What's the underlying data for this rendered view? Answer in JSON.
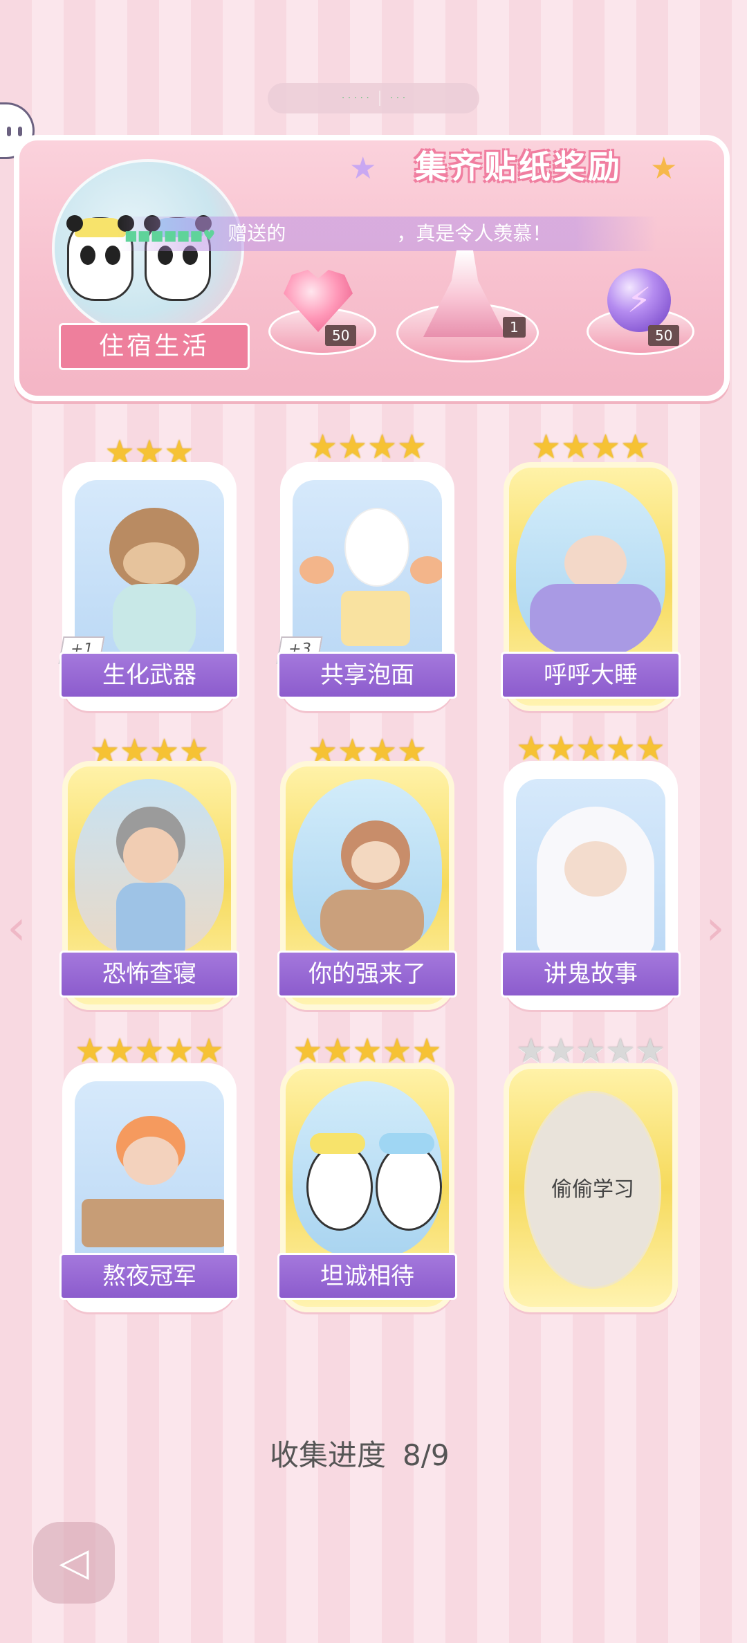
{
  "topbar": {
    "left_text": "· · · · ·",
    "right_text": "· · ·"
  },
  "banner": {
    "title": "集齐贴纸奖励",
    "ribbon_label": "住宿生活",
    "scroll_name": "■■■■■■♥",
    "scroll_text_gift": "赠送的",
    "scroll_text_envy": "，真是令人羡慕！",
    "rewards": [
      {
        "icon": "heart-gem-icon",
        "count": "50"
      },
      {
        "icon": "dress-icon",
        "count": "1"
      },
      {
        "icon": "orb-icon",
        "count": "50"
      }
    ]
  },
  "cards": [
    {
      "label": "生化武器",
      "stars": 3,
      "style": "white",
      "plus": "+1"
    },
    {
      "label": "共享泡面",
      "stars": 4,
      "style": "white",
      "plus": "+3"
    },
    {
      "label": "呼呼大睡",
      "stars": 4,
      "style": "gold"
    },
    {
      "label": "恐怖查寝",
      "stars": 4,
      "style": "gold"
    },
    {
      "label": "你的强来了",
      "stars": 4,
      "style": "gold"
    },
    {
      "label": "讲鬼故事",
      "stars": 5,
      "style": "white"
    },
    {
      "label": "熬夜冠军",
      "stars": 5,
      "style": "white"
    },
    {
      "label": "坦诚相待",
      "stars": 5,
      "style": "gold"
    },
    {
      "label": "偷偷学习",
      "stars": 5,
      "style": "gold",
      "locked": true
    }
  ],
  "progress": {
    "label": "收集进度",
    "value": "8/9"
  },
  "nav": {
    "left_arrow": "‹",
    "right_arrow": "›",
    "back_icon": "◁"
  },
  "colors": {
    "ribbon_purple": "#9a6ad6",
    "banner_pink": "#f7bfcd",
    "star_gold": "#f6c234",
    "star_grey": "#d9d9d9"
  }
}
